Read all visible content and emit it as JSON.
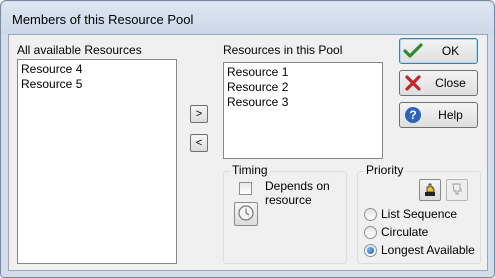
{
  "window": {
    "title": "Members of this Resource Pool"
  },
  "available": {
    "label": "All available Resources",
    "items": [
      "Resource 4",
      "Resource 5"
    ]
  },
  "pool": {
    "label": "Resources in this Pool",
    "items": [
      "Resource 1",
      "Resource 2",
      "Resource 3"
    ]
  },
  "move": {
    "add_label": ">",
    "remove_label": "<"
  },
  "timing": {
    "title": "Timing",
    "depends_label_line1": "Depends on",
    "depends_label_line2": "resource",
    "depends_checked": false
  },
  "priority": {
    "title": "Priority",
    "options": [
      "List Sequence",
      "Circulate",
      "Longest Available"
    ],
    "selected": "Longest Available"
  },
  "buttons": {
    "ok": "OK",
    "close": "Close",
    "help": "Help"
  },
  "colors": {
    "ok_check": "#2e8b2e",
    "close_x": "#c0282d",
    "help_circle": "#2a64b8"
  }
}
